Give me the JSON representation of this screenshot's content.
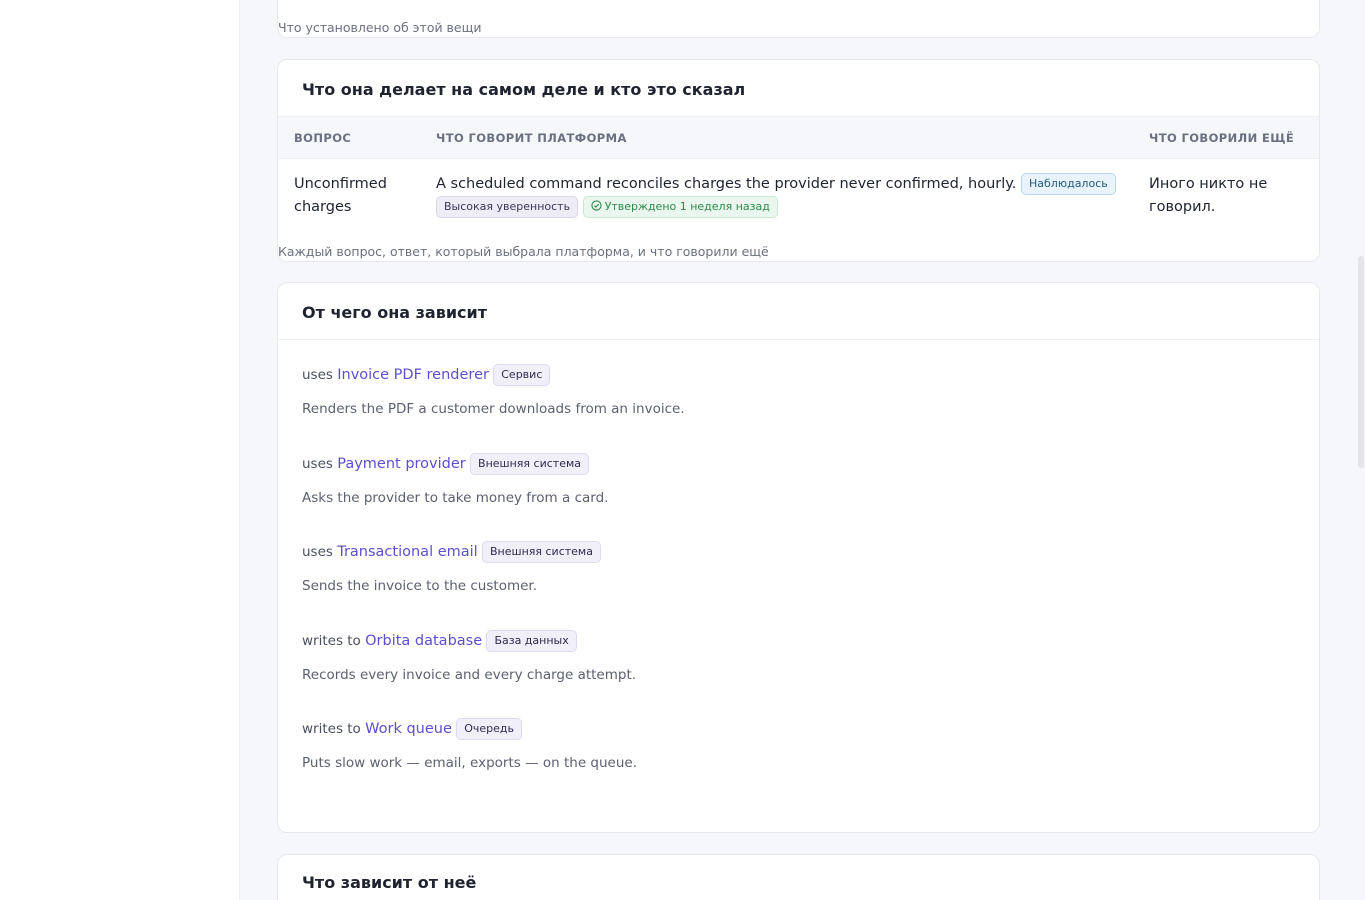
{
  "established": {
    "caption": "Что установлено об этой вещи"
  },
  "behavior": {
    "title": "Что она делает на самом деле и кто это сказал",
    "columns": [
      "ВОПРОС",
      "ЧТО ГОВОРИТ ПЛАТФОРМА",
      "ЧТО ГОВОРИЛИ ЕЩЁ"
    ],
    "rows": [
      {
        "question": "Unconfirmed charges",
        "answer": "A scheduled command reconciles charges the provider never confirmed, hourly.",
        "badge_observed": "Наблюдалось",
        "badge_confidence": "Высокая уверенность",
        "badge_approved": "Утверждено 1 неделя назад",
        "others": "Иного никто не говорил."
      }
    ],
    "caption": "Каждый вопрос, ответ, который выбрала платформа, и что говорили ещё"
  },
  "dependencies": {
    "title": "От чего она зависит",
    "items": [
      {
        "relation": "uses",
        "target": "Invoice PDF renderer",
        "kind": "Сервис",
        "description": "Renders the PDF a customer downloads from an invoice."
      },
      {
        "relation": "uses",
        "target": "Payment provider",
        "kind": "Внешняя система",
        "description": "Asks the provider to take money from a card."
      },
      {
        "relation": "uses",
        "target": "Transactional email",
        "kind": "Внешняя система",
        "description": "Sends the invoice to the customer."
      },
      {
        "relation": "writes to",
        "target": "Orbita database",
        "kind": "База данных",
        "description": "Records every invoice and every charge attempt."
      },
      {
        "relation": "writes to",
        "target": "Work queue",
        "kind": "Очередь",
        "description": "Puts slow work — email, exports — on the queue."
      }
    ]
  },
  "dependents": {
    "title": "Что зависит от неё"
  },
  "colors": {
    "link": "#5b4fd1",
    "approved": "#2f8a4e",
    "observed_border": "#b7d9f0"
  }
}
